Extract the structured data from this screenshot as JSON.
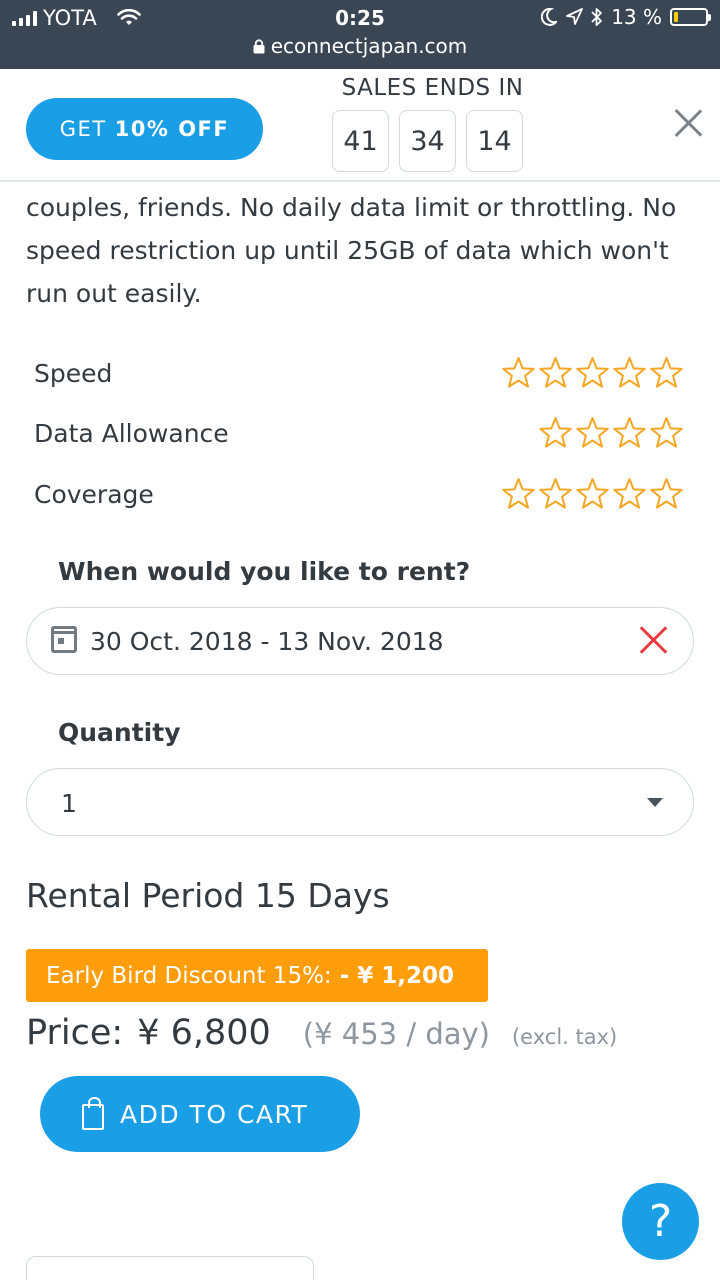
{
  "status_bar": {
    "carrier": "YOTA",
    "time": "0:25",
    "url": "econnectjapan.com",
    "battery": "13 %",
    "battery_level": 0.13
  },
  "promo": {
    "button_prefix": "GET",
    "button_bold": "10% OFF",
    "sales_label": "SALES ENDS IN",
    "timer": [
      "41",
      "34",
      "14"
    ]
  },
  "description": "couples, friends. No daily data limit or throttling. No speed restriction up until 25GB of data which won't run out easily.",
  "ratings": [
    {
      "label": "Speed",
      "stars": 5
    },
    {
      "label": "Data Allowance",
      "stars": 4
    },
    {
      "label": "Coverage",
      "stars": 5
    }
  ],
  "rent": {
    "label": "When would you like to rent?",
    "date_value": "30 Oct. 2018 - 13 Nov. 2018"
  },
  "quantity": {
    "label": "Quantity",
    "value": "1"
  },
  "rental_period": "Rental Period 15 Days",
  "discount": {
    "text": "Early Bird Discount 15%:",
    "amount": "- ¥ 1,200"
  },
  "price": {
    "label": "Price:",
    "value": "¥ 6,800",
    "per_day": "(¥ 453 / day)",
    "excl": "(excl. tax)"
  },
  "cart_button": "ADD TO CART",
  "help_label": "?",
  "colors": {
    "accent_blue": "#1a9ee6",
    "discount_orange": "#ff9d0b",
    "star_gold": "#f5a623",
    "clear_red": "#ee3a43"
  }
}
